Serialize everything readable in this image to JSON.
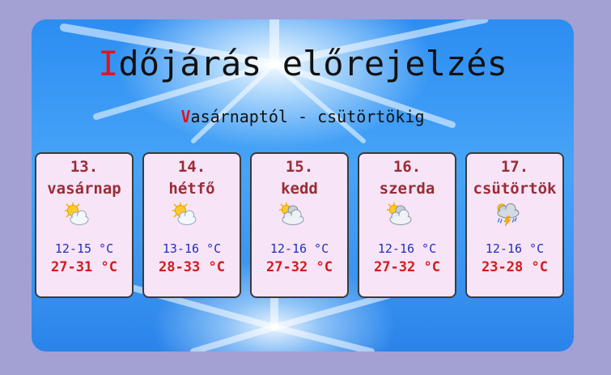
{
  "header": {
    "title_first": "I",
    "title_rest": "dőjárás előrejelzés",
    "subtitle_first": "V",
    "subtitle_rest": "asárnaptól - csütörtökig"
  },
  "days": [
    {
      "date": "13.",
      "name": "vasárnap",
      "icon": "partly-sunny-icon",
      "min": "12-15 °C",
      "max": "27-31 °C"
    },
    {
      "date": "14.",
      "name": "hétfő",
      "icon": "partly-sunny-icon",
      "min": "13-16 °C",
      "max": "28-33 °C"
    },
    {
      "date": "15.",
      "name": "kedd",
      "icon": "mostly-cloudy-icon",
      "min": "12-16 °C",
      "max": "27-32 °C"
    },
    {
      "date": "16.",
      "name": "szerda",
      "icon": "mostly-cloudy-icon",
      "min": "12-16 °C",
      "max": "27-32 °C"
    },
    {
      "date": "17.",
      "name": "csütörtök",
      "icon": "thunderstorm-icon",
      "min": "12-16 °C",
      "max": "23-28 °C"
    }
  ],
  "colors": {
    "page_bg": "#a3a0d4",
    "card_bg": "#f7e4f7",
    "day_text": "#9b2c36",
    "min_temp": "#1f2fbf",
    "max_temp": "#d21a1a",
    "accent_letter": "#e0141e"
  }
}
